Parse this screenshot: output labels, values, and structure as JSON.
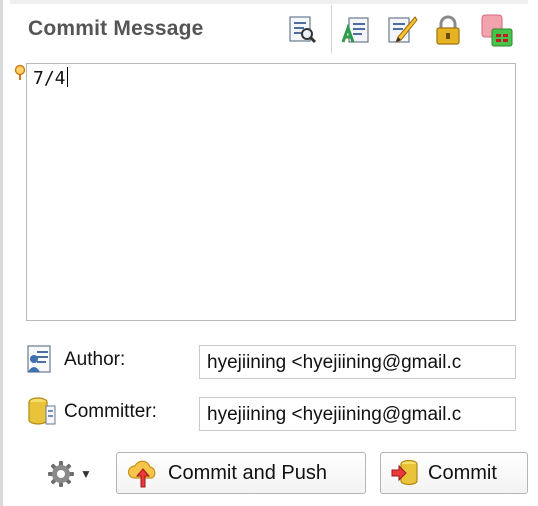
{
  "panel": {
    "title": "Commit Message"
  },
  "toolbar": {
    "icons": [
      "preview-icon",
      "sign-off-icon",
      "spell-edit-icon",
      "lock-icon",
      "staging-icon"
    ]
  },
  "message": {
    "value": "7/4"
  },
  "author": {
    "label": "Author:",
    "value": "hyejiining <hyejiining@gmail.c"
  },
  "committer": {
    "label": "Committer:",
    "value": "hyejiining <hyejiining@gmail.c"
  },
  "actions": {
    "commit_and_push_label": "Commit and Push",
    "commit_label": "Commit"
  },
  "colors": {
    "title": "#555555",
    "border": "#b9b9b9",
    "accent_gold": "#e0b020"
  }
}
